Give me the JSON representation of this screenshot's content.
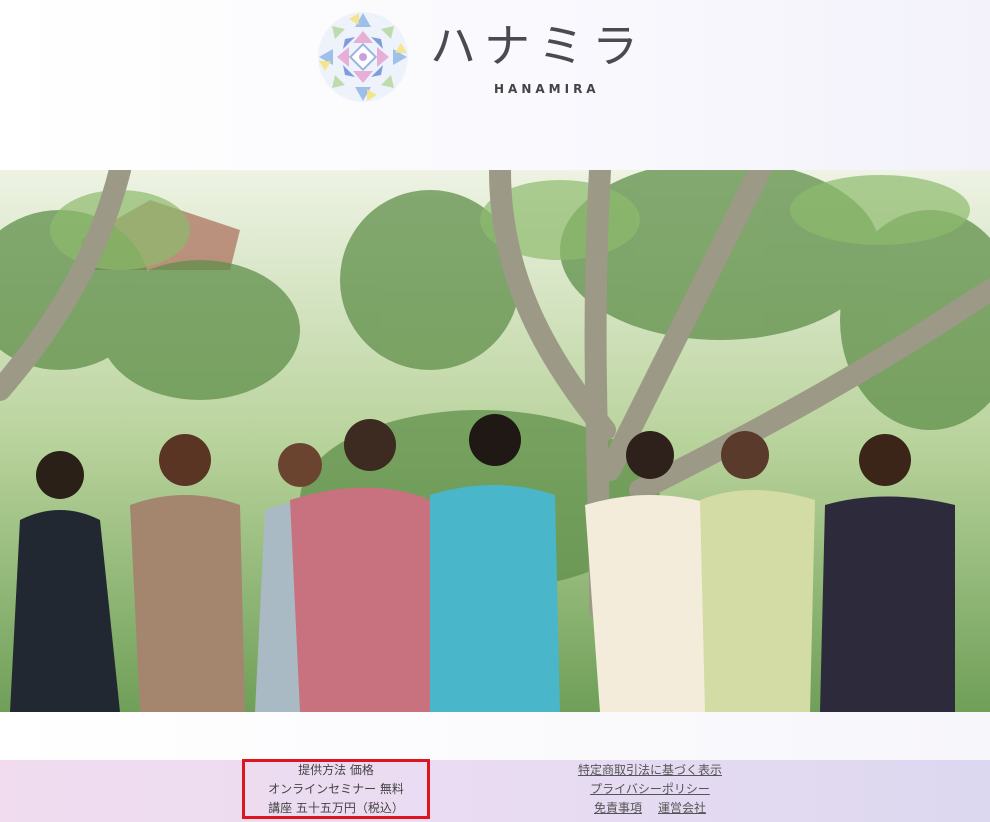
{
  "header": {
    "logo_jp": "ハナミラ",
    "logo_en": "HANAMIRA",
    "logo_icon": "mandala-logo-icon"
  },
  "hero": {
    "icon": "group-photo-image",
    "colors": {
      "foliage_light": "#d7e6c4",
      "foliage_dark": "#5f8f4a",
      "trunk": "#9c9a86",
      "roof": "#b07a66"
    }
  },
  "footer": {
    "info": {
      "line1": "提供方法 価格",
      "line2": "オンラインセミナー 無料",
      "line3": "講座 五十五万円（税込）"
    },
    "links": {
      "tokushoho": "特定商取引法に基づく表示",
      "privacy": "プライバシーポリシー",
      "disclaimer": "免責事項",
      "company": "運営会社"
    },
    "highlight_color": "#e0141f"
  }
}
